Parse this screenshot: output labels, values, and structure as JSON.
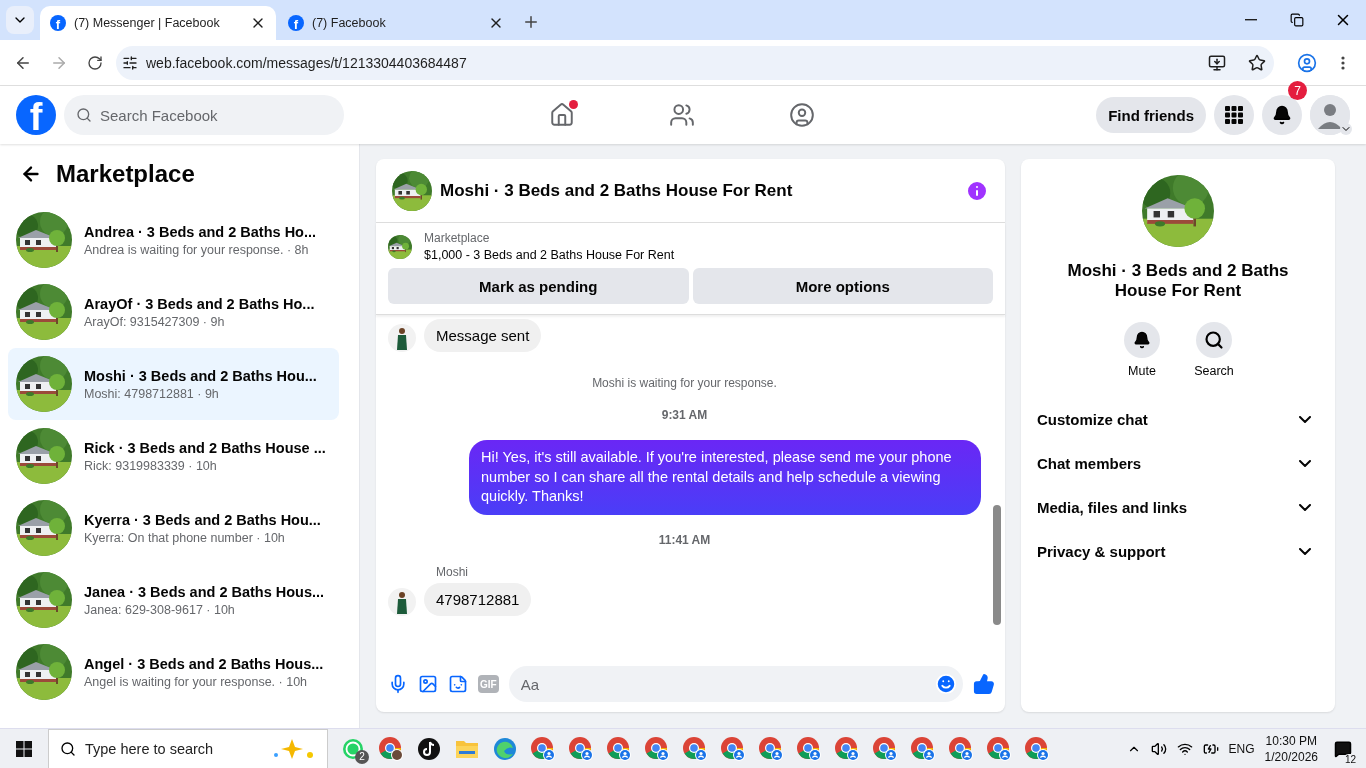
{
  "browser": {
    "tabs": [
      {
        "favicon": "f",
        "title": "(7) Messenger | Facebook",
        "selected": true
      },
      {
        "favicon": "f",
        "title": "(7) Facebook",
        "selected": false
      }
    ],
    "url": "web.facebook.com/messages/t/1213304403684487"
  },
  "header": {
    "logo": "f",
    "search_placeholder": "Search Facebook",
    "nav": [
      {
        "kind": "home",
        "dot": true
      },
      {
        "kind": "friends",
        "dot": false
      },
      {
        "kind": "groups",
        "dot": false
      }
    ],
    "find_friends": "Find friends",
    "notifications_badge": "7"
  },
  "sidebar": {
    "title": "Marketplace",
    "conversations": [
      {
        "title": "Andrea · 3 Beds and 2 Baths Ho...",
        "preview": "Andrea is waiting for your response. · 8h",
        "selected": false
      },
      {
        "title": "ArayOf · 3 Beds and 2 Baths Ho...",
        "preview": "ArayOf: 9315427309 · 9h",
        "selected": false
      },
      {
        "title": "Moshi · 3 Beds and 2 Baths Hou...",
        "preview": "Moshi: 4798712881 · 9h",
        "selected": true
      },
      {
        "title": "Rick · 3 Beds and 2 Baths House ...",
        "preview": "Rick: 9319983339 · 10h",
        "selected": false
      },
      {
        "title": "Kyerra · 3 Beds and 2 Baths Hou...",
        "preview": "Kyerra: On that phone number · 10h",
        "selected": false
      },
      {
        "title": "Janea · 3 Beds and 2 Baths Hous...",
        "preview": "Janea: 629-308-9617 · 10h",
        "selected": false
      },
      {
        "title": "Angel · 3 Beds and 2 Baths Hous...",
        "preview": "Angel is waiting for your response. · 10h",
        "selected": false
      }
    ]
  },
  "chat": {
    "title": "Moshi · 3 Beds and 2 Baths House For Rent",
    "listing": {
      "label": "Marketplace",
      "detail": "$1,000 - 3 Beds and 2 Baths House For Rent"
    },
    "actions": [
      "Mark as pending",
      "More options"
    ],
    "messages": [
      {
        "kind": "incoming",
        "text": "Message sent"
      },
      {
        "kind": "notice",
        "text": "Moshi is waiting for your response."
      },
      {
        "kind": "time",
        "text": "9:31 AM"
      },
      {
        "kind": "outgoing",
        "text": "Hi! Yes, it's still available. If you're interested, please send me your phone number so I can share all the rental details and help schedule a viewing quickly. Thanks!"
      },
      {
        "kind": "time",
        "text": "11:41 AM"
      },
      {
        "kind": "incoming",
        "sender": "Moshi",
        "text": "4798712881"
      }
    ],
    "composer": {
      "gif": "GIF",
      "placeholder": "Aa"
    }
  },
  "details": {
    "title": "Moshi · 3 Beds and 2 Baths House For Rent",
    "actions": [
      {
        "kind": "mute",
        "label": "Mute"
      },
      {
        "kind": "search",
        "label": "Search"
      }
    ],
    "sections": [
      {
        "label": "Customize chat",
        "expanded": false
      },
      {
        "label": "Chat members",
        "expanded": false
      },
      {
        "label": "Media, files and links",
        "expanded": false
      },
      {
        "label": "Privacy & support",
        "expanded": false
      }
    ]
  },
  "taskbar": {
    "search_placeholder": "Type here to search",
    "apps": [
      {
        "kind": "whatsapp",
        "badge": "2"
      },
      {
        "kind": "chrome-photo"
      },
      {
        "kind": "tiktok"
      },
      {
        "kind": "folder"
      },
      {
        "kind": "edge"
      },
      {
        "kind": "chrome"
      },
      {
        "kind": "chrome"
      },
      {
        "kind": "chrome"
      },
      {
        "kind": "chrome"
      },
      {
        "kind": "chrome"
      },
      {
        "kind": "chrome"
      },
      {
        "kind": "chrome"
      },
      {
        "kind": "chrome"
      },
      {
        "kind": "chrome"
      },
      {
        "kind": "chrome"
      },
      {
        "kind": "chrome"
      },
      {
        "kind": "chrome"
      },
      {
        "kind": "chrome"
      },
      {
        "kind": "chrome"
      }
    ],
    "language": "ENG",
    "time": "10:30 PM",
    "date": "1/20/2026",
    "notifications": "12"
  }
}
